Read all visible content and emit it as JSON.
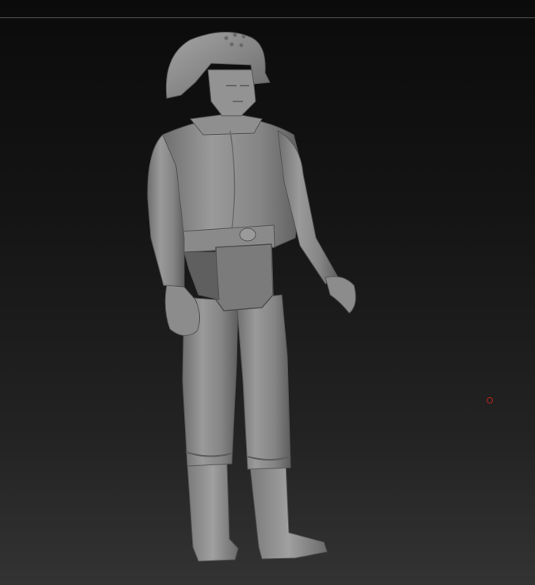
{
  "viewport": {
    "background_top": "#0b0b0b",
    "background_bottom": "#333333",
    "edge_line_color": "#5a5a5a"
  },
  "model": {
    "material_color": "#8c8c8c",
    "shadow_color": "#4a4a4a"
  },
  "pivot_marker": {
    "color": "#b3261e"
  }
}
